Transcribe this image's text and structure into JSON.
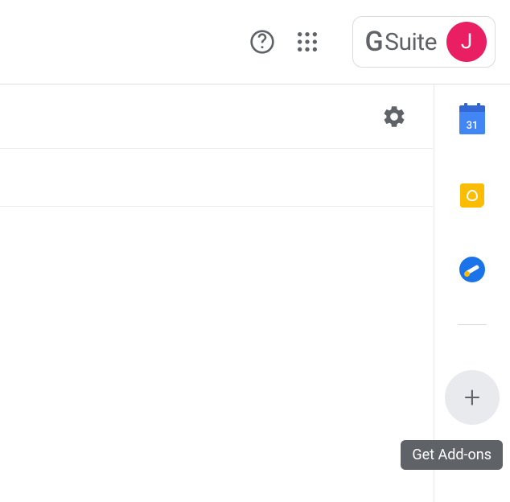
{
  "header": {
    "suite_label": "Suite",
    "avatar_initial": "J"
  },
  "sidepanel": {
    "calendar_day": "31"
  },
  "tooltip": {
    "text": "Get Add-ons"
  }
}
